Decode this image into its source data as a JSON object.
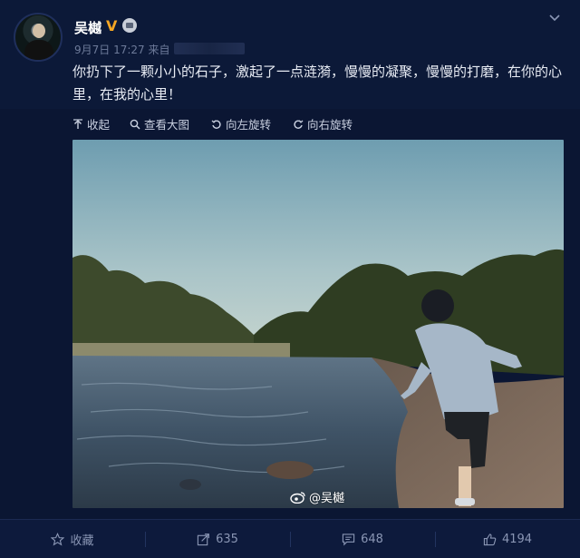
{
  "user": {
    "name": "吴樾",
    "verified_mark": "V"
  },
  "post": {
    "date": "9月7日 17:27",
    "source_prefix": "来自",
    "text": "你扔下了一颗小小的石子，激起了一点涟漪，慢慢的凝聚，慢慢的打磨，在你的心里，在我的心里！"
  },
  "image_toolbar": {
    "collapse": "收起",
    "view_large": "查看大图",
    "rotate_left": "向左旋转",
    "rotate_right": "向右旋转"
  },
  "watermark": {
    "text": "@吴樾"
  },
  "actions": {
    "favorite": "收藏",
    "repost_count": "635",
    "comment_count": "648",
    "like_count": "4194"
  },
  "colors": {
    "background": "#0b1633",
    "accent_badge": "#f5a623",
    "muted_text": "#6d7a99"
  },
  "icons": [
    "chevron-down-icon",
    "collapse-icon",
    "search-icon",
    "rotate-left-icon",
    "rotate-right-icon",
    "weibo-icon",
    "star-icon",
    "share-icon",
    "comment-icon",
    "thumbs-up-icon",
    "crown-icon"
  ]
}
